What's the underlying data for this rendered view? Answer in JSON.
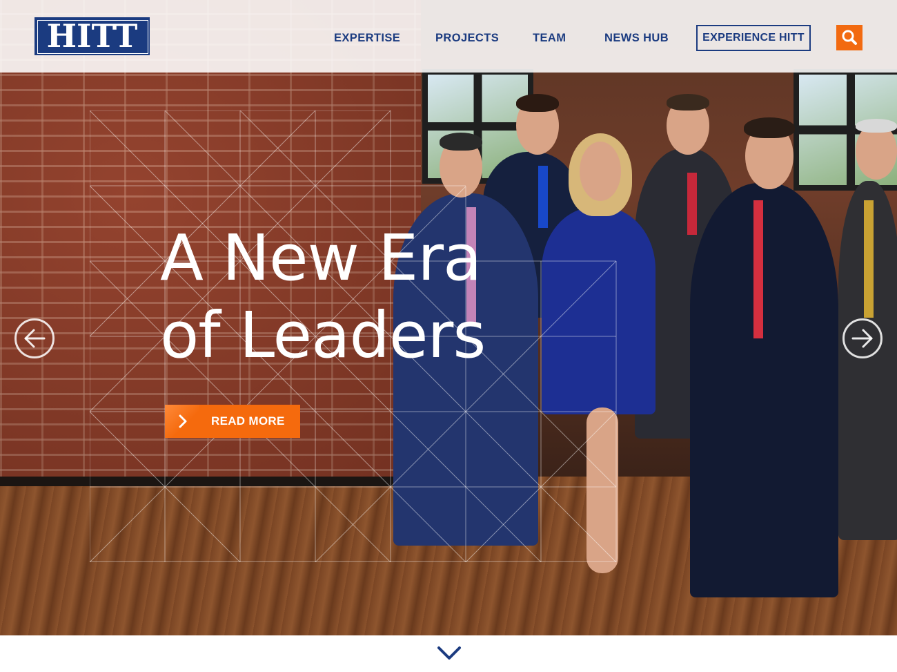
{
  "brand": {
    "logo_text": "HITT",
    "primary_color": "#1b3b80",
    "accent_color": "#f26a10"
  },
  "nav": {
    "items": [
      {
        "label": "EXPERTISE"
      },
      {
        "label": "PROJECTS"
      },
      {
        "label": "TEAM"
      },
      {
        "label": "NEWS HUB"
      }
    ],
    "cta_label": "EXPERIENCE HITT",
    "search_icon": "search-icon"
  },
  "hero": {
    "headline_line1": "A New Era",
    "headline_line2": "of Leaders",
    "cta_label": "READ MORE",
    "prev_icon": "arrow-left-circle-icon",
    "next_icon": "arrow-right-circle-icon"
  },
  "footer": {
    "scroll_icon": "chevron-down-icon"
  }
}
